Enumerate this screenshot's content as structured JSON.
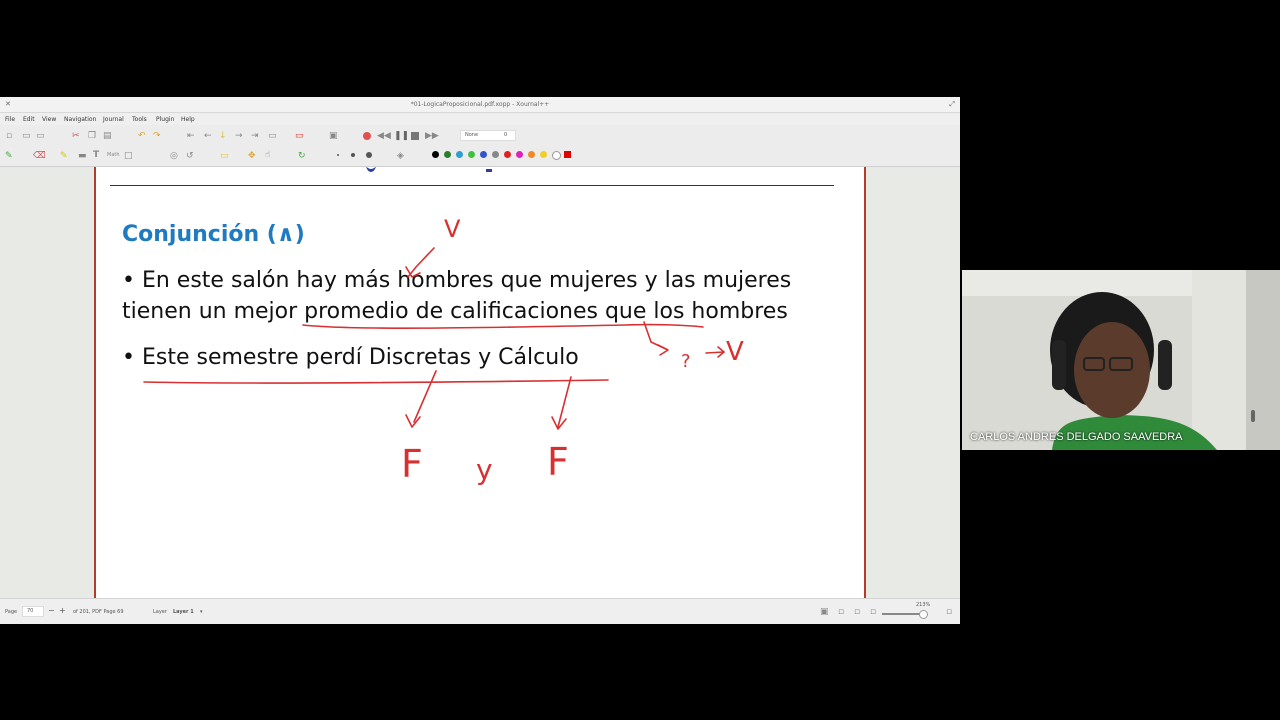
{
  "window": {
    "title": "*01-LogicaProposicional.pdf.xopp - Xournal++"
  },
  "menu": [
    "File",
    "Edit",
    "View",
    "Navigation",
    "Journal",
    "Tools",
    "Plugin",
    "Help"
  ],
  "toolbar": {
    "zoom_select": "None",
    "zoom_value": "0"
  },
  "colors": {
    "palette": [
      "#000000",
      "#2a7f2a",
      "#2ca0d0",
      "#3fc23f",
      "#3355cc",
      "#888888",
      "#e02020",
      "#e020c0",
      "#f08a20",
      "#f2d020",
      "#ffffff",
      "#e00000"
    ],
    "ink": "#d83030",
    "title_blue": "#1f7abf"
  },
  "slide": {
    "title": "Conjunción (∧)",
    "bullet1_line1": "• En este salón hay más hombres que mujeres y las mujeres",
    "bullet1_line2": "tienen un mejor promedio de calificaciones que los hombres",
    "bullet2": "• Este semestre perdí Discretas y Cálculo"
  },
  "annotations": {
    "mark1": "V",
    "mark2": "V",
    "mark3": "?",
    "mark4": "F",
    "mark5": "y",
    "mark6": "F"
  },
  "status": {
    "page_label": "Page",
    "page_value": "70",
    "page_info": "of 201, PDF Page 69",
    "layer_label": "Layer",
    "layer_value": "Layer 1",
    "zoom": "213%"
  },
  "participant": {
    "name": "CARLOS ANDRES DELGADO SAAVEDRA"
  }
}
